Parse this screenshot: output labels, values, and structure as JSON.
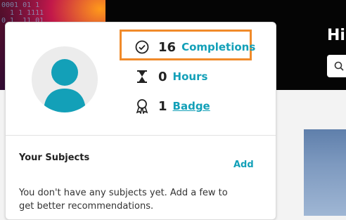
{
  "hero": {
    "greeting": "Hi",
    "bits_text": "0001 01 1\n  1 1 1111\n0 1  11 01"
  },
  "profile": {
    "stats": {
      "completions": {
        "value": "16",
        "label": "Completions",
        "icon": "check-circle-icon"
      },
      "hours": {
        "value": "0",
        "label": "Hours",
        "icon": "hourglass-icon"
      },
      "badge": {
        "value": "1",
        "label": "Badge",
        "icon": "award-ribbon-icon"
      }
    }
  },
  "subjects": {
    "title": "Your Subjects",
    "add_label": "Add",
    "empty_message": "You don't have any subjects yet. Add a few to get better recommendations."
  },
  "colors": {
    "accent": "#13a0b8",
    "highlight": "#f08a2a",
    "avatar": "#13a0b8"
  }
}
